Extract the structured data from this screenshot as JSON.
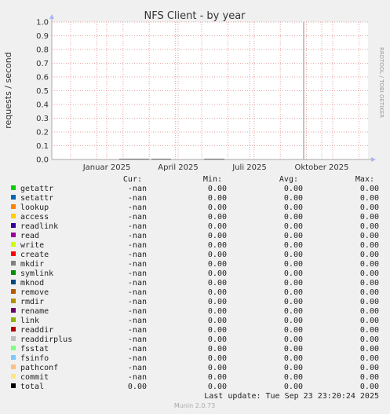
{
  "chart_data": {
    "type": "line",
    "title": "NFS Client - by year",
    "ylabel": "requests / second",
    "side_label": "RRDTOOL / TOBI OETIKER",
    "ylim": [
      0,
      1
    ],
    "y_ticks": [
      "0.0",
      "0.1",
      "0.2",
      "0.3",
      "0.4",
      "0.5",
      "0.6",
      "0.7",
      "0.8",
      "0.9",
      "1.0"
    ],
    "x_ticks": [
      "Januar 2025",
      "April 2025",
      "Juli 2025",
      "Oktober 2025"
    ],
    "grid": true,
    "spike_at": "Oktober 2025 (early September)",
    "legend": {
      "headers": {
        "cur": "Cur:",
        "min": "Min:",
        "avg": "Avg:",
        "max": "Max:"
      },
      "rows": [
        {
          "name": "getattr",
          "color": "#00cc00",
          "cur": "-nan",
          "min": "0.00",
          "avg": "0.00",
          "max": "0.00"
        },
        {
          "name": "setattr",
          "color": "#0066b3",
          "cur": "-nan",
          "min": "0.00",
          "avg": "0.00",
          "max": "0.00"
        },
        {
          "name": "lookup",
          "color": "#ff8000",
          "cur": "-nan",
          "min": "0.00",
          "avg": "0.00",
          "max": "0.00"
        },
        {
          "name": "access",
          "color": "#ffcc00",
          "cur": "-nan",
          "min": "0.00",
          "avg": "0.00",
          "max": "0.00"
        },
        {
          "name": "readlink",
          "color": "#330099",
          "cur": "-nan",
          "min": "0.00",
          "avg": "0.00",
          "max": "0.00"
        },
        {
          "name": "read",
          "color": "#990099",
          "cur": "-nan",
          "min": "0.00",
          "avg": "0.00",
          "max": "0.00"
        },
        {
          "name": "write",
          "color": "#ccff00",
          "cur": "-nan",
          "min": "0.00",
          "avg": "0.00",
          "max": "0.00"
        },
        {
          "name": "create",
          "color": "#ff0000",
          "cur": "-nan",
          "min": "0.00",
          "avg": "0.00",
          "max": "0.00"
        },
        {
          "name": "mkdir",
          "color": "#808080",
          "cur": "-nan",
          "min": "0.00",
          "avg": "0.00",
          "max": "0.00"
        },
        {
          "name": "symlink",
          "color": "#008f00",
          "cur": "-nan",
          "min": "0.00",
          "avg": "0.00",
          "max": "0.00"
        },
        {
          "name": "mknod",
          "color": "#00487d",
          "cur": "-nan",
          "min": "0.00",
          "avg": "0.00",
          "max": "0.00"
        },
        {
          "name": "remove",
          "color": "#b35a00",
          "cur": "-nan",
          "min": "0.00",
          "avg": "0.00",
          "max": "0.00"
        },
        {
          "name": "rmdir",
          "color": "#b38f00",
          "cur": "-nan",
          "min": "0.00",
          "avg": "0.00",
          "max": "0.00"
        },
        {
          "name": "rename",
          "color": "#6b006b",
          "cur": "-nan",
          "min": "0.00",
          "avg": "0.00",
          "max": "0.00"
        },
        {
          "name": "link",
          "color": "#8fb300",
          "cur": "-nan",
          "min": "0.00",
          "avg": "0.00",
          "max": "0.00"
        },
        {
          "name": "readdir",
          "color": "#b30000",
          "cur": "-nan",
          "min": "0.00",
          "avg": "0.00",
          "max": "0.00"
        },
        {
          "name": "readdirplus",
          "color": "#bebebe",
          "cur": "-nan",
          "min": "0.00",
          "avg": "0.00",
          "max": "0.00"
        },
        {
          "name": "fsstat",
          "color": "#80ff80",
          "cur": "-nan",
          "min": "0.00",
          "avg": "0.00",
          "max": "0.00"
        },
        {
          "name": "fsinfo",
          "color": "#80c9ff",
          "cur": "-nan",
          "min": "0.00",
          "avg": "0.00",
          "max": "0.00"
        },
        {
          "name": "pathconf",
          "color": "#ffc080",
          "cur": "-nan",
          "min": "0.00",
          "avg": "0.00",
          "max": "0.00"
        },
        {
          "name": "commit",
          "color": "#ffe680",
          "cur": "-nan",
          "min": "0.00",
          "avg": "0.00",
          "max": "0.00"
        },
        {
          "name": "total",
          "color": "#000000",
          "cur": "0.00",
          "min": "0.00",
          "avg": "0.00",
          "max": "0.00"
        }
      ]
    },
    "last_update": "Last update: Tue Sep 23 23:20:24 2025",
    "footer": "Munin 2.0.73"
  }
}
